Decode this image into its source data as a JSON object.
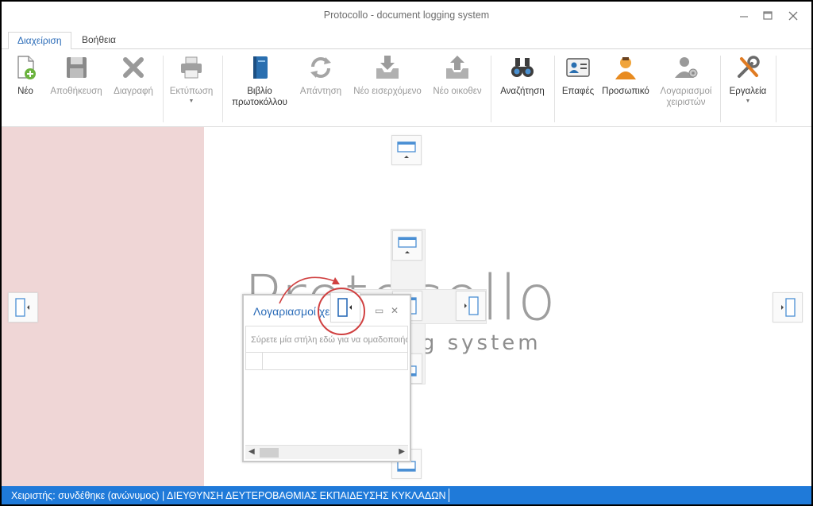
{
  "window": {
    "title": "Protocollo - document logging system"
  },
  "tabs": [
    {
      "label": "Διαχείριση",
      "active": true
    },
    {
      "label": "Βοήθεια",
      "active": false
    }
  ],
  "ribbon": {
    "new": "Νέο",
    "save": "Αποθήκευση",
    "delete": "Διαγραφή",
    "print": "Εκτύπωση",
    "book_line1": "Βιβλίο",
    "book_line2": "πρωτοκόλλου",
    "reply": "Απάντηση",
    "incoming": "Νέο εισερχόμενο",
    "outgoing": "Νέο οικοθεν",
    "search": "Αναζήτηση",
    "contacts": "Επαφές",
    "personnel": "Προσωπικό",
    "accounts_line1": "Λογαριασμοί",
    "accounts_line2": "χειριστών",
    "tools": "Εργαλεία"
  },
  "watermark": {
    "brand": "Protocollo",
    "tagline": "logging system"
  },
  "float_panel": {
    "title": "Λογαριασμοί χειριστών",
    "group_hint": "Σύρετε μία στήλη εδώ για να ομαδοποιήσετε"
  },
  "status": {
    "text": "Χειριστής: συνδέθηκε (ανώνυμος) | ΔΙΕΥΘΥΝΣΗ ΔΕΥΤΕΡΟΒΑΘΜΙΑΣ ΕΚΠΑΙΔΕΥΣΗΣ ΚΥΚΛΑΔΩΝ"
  },
  "colors": {
    "accent": "#2b6cb8",
    "status_bar": "#1f7ad9",
    "left_dock_zone": "#efd6d6",
    "callout": "#d04040"
  }
}
